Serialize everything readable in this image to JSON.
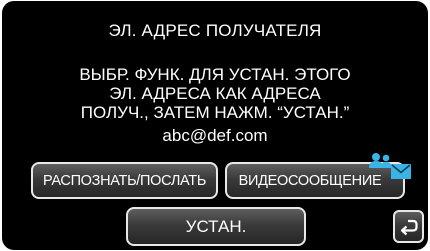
{
  "header": {
    "title": "ЭЛ. АДРЕС ПОЛУЧАТЕЛЯ"
  },
  "message": {
    "lines": [
      "ВЫБР. ФУНК. ДЛЯ УСТАН. ЭТОГО",
      "ЭЛ. АДРЕСА КАК АДРЕСА",
      "ПОЛУЧ., ЗАТЕМ НАЖМ. “УСТАН.”"
    ],
    "email": "abc@def.com"
  },
  "buttons": {
    "recognize_send_label": "РАСПОЗНАТЬ/ПОСЛАТЬ",
    "video_message_label": "ВИДЕОСООБЩЕНИЕ",
    "set_label": "УСТАН."
  },
  "icons": {
    "mail": "envelope-people-icon",
    "back": "return-arrow-icon"
  },
  "colors": {
    "background": "#000000",
    "text": "#ffffff",
    "button_border": "#e8e8e8",
    "accent_icon": "#3ab4e6"
  }
}
